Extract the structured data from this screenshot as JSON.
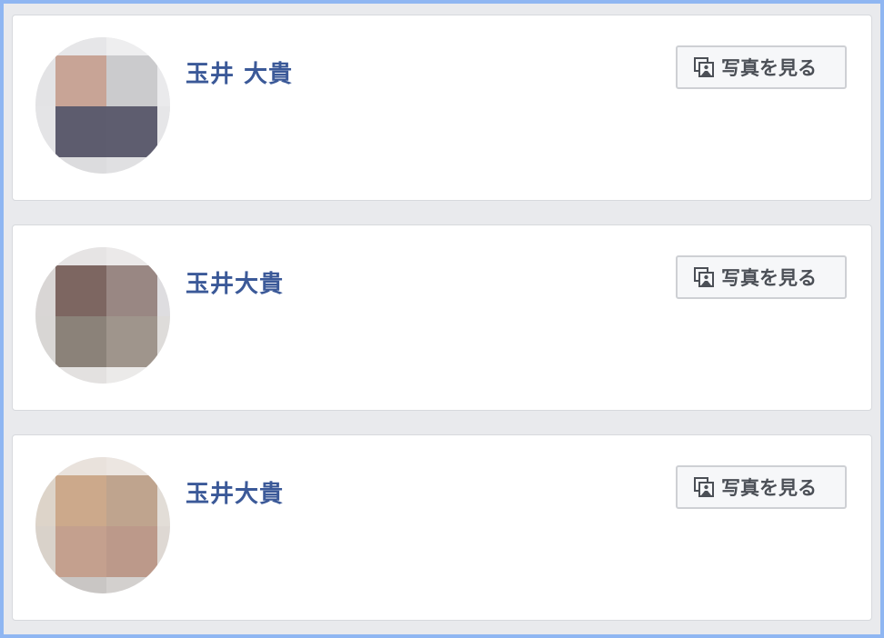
{
  "colors": {
    "name_link": "#3b5998",
    "button_text": "#4b4f56",
    "button_bg": "#f6f7f9",
    "card_border": "#d7d9dd",
    "page_bg": "#e9eaed",
    "frame": "#8fb6f2"
  },
  "results": [
    {
      "name": "玉井 大貴",
      "view_photos_label": "写真を見る",
      "icon": "photos-icon",
      "avatar_pixels": [
        [
          "#dcdcdd",
          "#e6e6e8",
          "#eeeeef",
          "#f0f0f1"
        ],
        [
          "#e3e3e5",
          "#c8a496",
          "#cbcbcd",
          "#eaeaec"
        ],
        [
          "#e4e4e6",
          "#5d5c6e",
          "#5e5d6f",
          "#e6e6e8"
        ],
        [
          "#e3e3e5",
          "#dcdcde",
          "#e0e0e2",
          "#ececee"
        ]
      ]
    },
    {
      "name": "玉井大貴",
      "view_photos_label": "写真を見る",
      "icon": "photos-icon",
      "avatar_pixels": [
        [
          "#e2e0e0",
          "#e6e4e4",
          "#ebe9e9",
          "#eeeeee"
        ],
        [
          "#d9d6d5",
          "#7d6661",
          "#998783",
          "#dedde0"
        ],
        [
          "#d8d6d4",
          "#8b8279",
          "#9f958c",
          "#dedcda"
        ],
        [
          "#e2e0df",
          "#e3e1e0",
          "#ebeae9",
          "#eeeeee"
        ]
      ]
    },
    {
      "name": "玉井大貴",
      "view_photos_label": "写真を見る",
      "icon": "photos-icon",
      "avatar_pixels": [
        [
          "#ebe7e3",
          "#e9e2dc",
          "#ece6e1",
          "#efefef"
        ],
        [
          "#ddd4c9",
          "#cca98b",
          "#bfa48e",
          "#e2ddd7"
        ],
        [
          "#d9d2ca",
          "#c4a08e",
          "#bc998a",
          "#ded8d3"
        ],
        [
          "#dfdbd8",
          "#c9c6c4",
          "#d3d0ce",
          "#e7e5e3"
        ]
      ]
    }
  ]
}
